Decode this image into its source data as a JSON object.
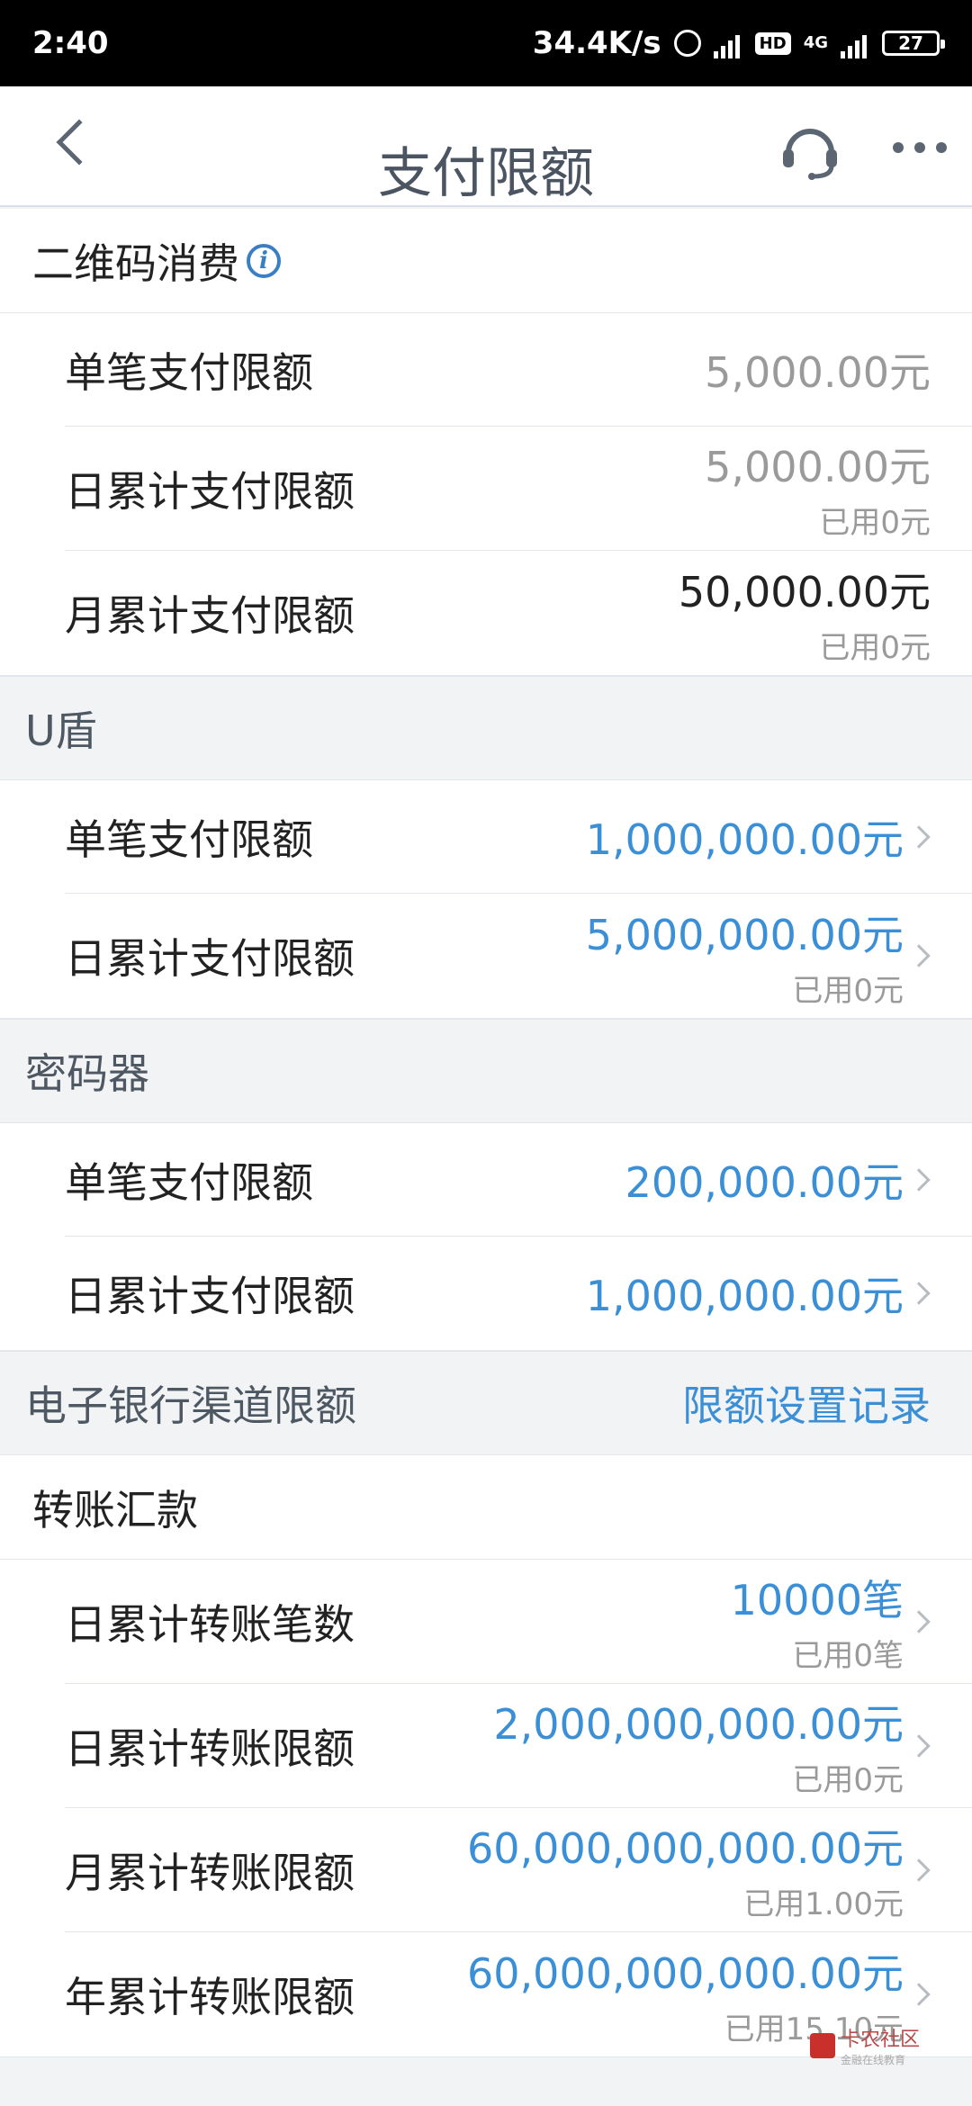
{
  "status_bar": {
    "time": "2:40",
    "speed": "34.4K/s",
    "hd": "HD",
    "network": "4G",
    "battery": "27"
  },
  "nav": {
    "title": "支付限额"
  },
  "qr_section": {
    "title": "二维码消费",
    "info": "i",
    "rows": [
      {
        "label": "单笔支付限额",
        "value": "5,000.00元"
      },
      {
        "label": "日累计支付限额",
        "value": "5,000.00元",
        "used": "已用0元"
      },
      {
        "label": "月累计支付限额",
        "value": "50,000.00元",
        "used": "已用0元"
      }
    ]
  },
  "ushield_section": {
    "title": "U盾",
    "rows": [
      {
        "label": "单笔支付限额",
        "value": "1,000,000.00元"
      },
      {
        "label": "日累计支付限额",
        "value": "5,000,000.00元",
        "used": "已用0元"
      }
    ]
  },
  "token_section": {
    "title": "密码器",
    "rows": [
      {
        "label": "单笔支付限额",
        "value": "200,000.00元"
      },
      {
        "label": "日累计支付限额",
        "value": "1,000,000.00元"
      }
    ]
  },
  "ebank_section": {
    "title": "电子银行渠道限额",
    "link": "限额设置记录"
  },
  "transfer_section": {
    "title": "转账汇款",
    "rows": [
      {
        "label": "日累计转账笔数",
        "value": "10000笔",
        "used": "已用0笔"
      },
      {
        "label": "日累计转账限额",
        "value": "2,000,000,000.00元",
        "used": "已用0元"
      },
      {
        "label": "月累计转账限额",
        "value": "60,000,000,000.00元",
        "used": "已用1.00元"
      },
      {
        "label": "年累计转账限额",
        "value": "60,000,000,000.00元",
        "used": "已用15.10元"
      }
    ]
  },
  "watermark": {
    "name": "卡农社区",
    "sub": "金融在线教育"
  },
  "colors": {
    "accent_blue": "#3a8fd6",
    "muted_gray": "#9a9a9a"
  }
}
